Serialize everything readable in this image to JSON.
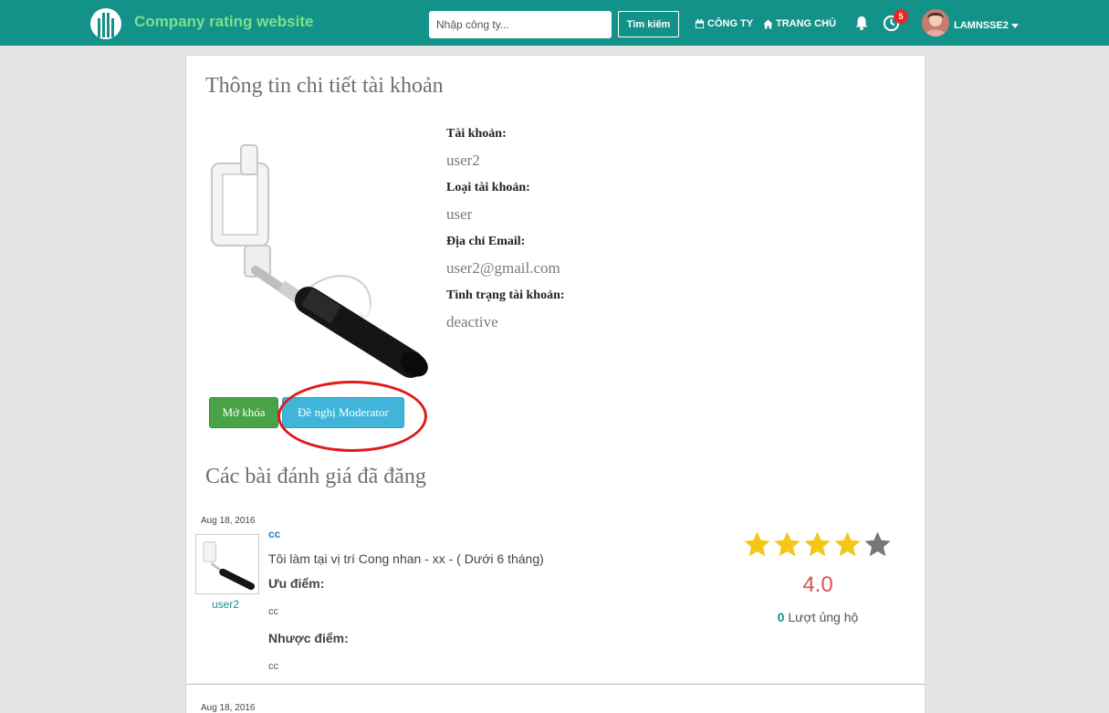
{
  "nav": {
    "brand": "Company rating website",
    "search_placeholder": "Nhập công ty...",
    "search_button": "Tìm kiếm",
    "company_link": "CÔNG TY",
    "home_link": "TRANG CHỦ",
    "history_badge": "5",
    "username": "LAMNSSE2",
    "icons": [
      "building-logo-icon",
      "calendar-icon",
      "home-icon",
      "bell-icon",
      "history-icon",
      "caret-down-icon"
    ]
  },
  "profile": {
    "title": "Thông tin chi tiết tài khoản",
    "fields": [
      {
        "label": "Tài khoản:",
        "value": "user2"
      },
      {
        "label": "Loại tài khoản:",
        "value": "user"
      },
      {
        "label": "Địa chỉ Email:",
        "value": "user2@gmail.com"
      },
      {
        "label": "Tình trạng tài khoản:",
        "value": "deactive"
      }
    ],
    "unlock_button": "Mở khóa",
    "moderator_button": "Đề nghị Moderator"
  },
  "reviews": {
    "title": "Các bài đánh giá đã đăng",
    "items": [
      {
        "date": "Aug 18, 2016",
        "user": "user2",
        "company": "cc",
        "description": "Tôi làm tại vị trí Cong nhan - xx - ( Dưới 6 tháng)",
        "pros_label": "Ưu điểm:",
        "pros": "cc",
        "cons_label": "Nhược điểm:",
        "cons": "cc",
        "stars_filled": 4,
        "stars_total": 5,
        "rating": "4.0",
        "support_count": "0",
        "support_label": "Lượt ủng hộ"
      },
      {
        "date": "Aug 18, 2016"
      }
    ]
  },
  "colors": {
    "navbar": "#139289",
    "brand": "#7de08c",
    "unlock_button": "#4aa447",
    "moderator_button": "#40b4d9",
    "star_filled": "#f5c518",
    "star_empty": "#777777",
    "rating": "#d9534f",
    "highlight_ring": "#e11a1a"
  }
}
